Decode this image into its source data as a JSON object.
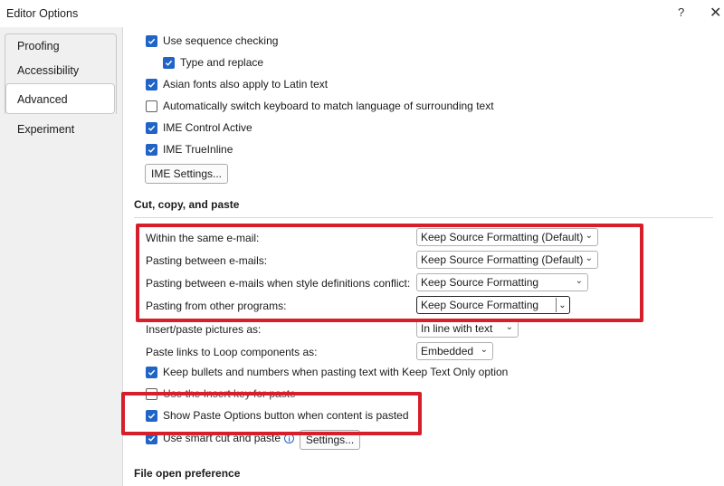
{
  "window": {
    "title": "Editor Options",
    "help": "?",
    "close": "✕"
  },
  "sidebar": {
    "items": [
      {
        "label": "Proofing"
      },
      {
        "label": "Accessibility"
      },
      {
        "label": "Advanced"
      },
      {
        "label": "Experiment"
      }
    ]
  },
  "options_top": [
    {
      "label": "Use sequence checking",
      "checked": true
    },
    {
      "label": "Type and replace",
      "checked": true
    },
    {
      "label": "Asian fonts also apply to Latin text",
      "checked": true
    },
    {
      "label": "Automatically switch keyboard to match language of surrounding text",
      "checked": false
    },
    {
      "label": "IME Control Active",
      "checked": true
    },
    {
      "label": "IME TrueInline",
      "checked": true
    }
  ],
  "ime_settings_button": "IME Settings...",
  "sections": {
    "cut_copy_paste": "Cut, copy, and paste",
    "file_open": "File open preference"
  },
  "paste_settings": [
    {
      "label": "Within the same e-mail:",
      "value": "Keep Source Formatting (Default)"
    },
    {
      "label": "Pasting between e-mails:",
      "value": "Keep Source Formatting (Default)"
    },
    {
      "label": "Pasting between e-mails when style definitions conflict:",
      "value": "Keep Source Formatting"
    },
    {
      "label": "Pasting from other programs:",
      "value": "Keep Source Formatting"
    },
    {
      "label": "Insert/paste pictures as:",
      "value": "In line with text"
    },
    {
      "label": "Paste links to Loop components as:",
      "value": "Embedded"
    }
  ],
  "options_bottom": [
    {
      "label": "Keep bullets and numbers when pasting text with Keep Text Only option",
      "checked": true
    },
    {
      "label": "Use the Insert key for paste",
      "checked": false
    },
    {
      "label": "Show Paste Options button when content is pasted",
      "checked": true
    },
    {
      "label": "Use smart cut and paste",
      "checked": true
    }
  ],
  "settings_button": "Settings...",
  "info_icon": "i",
  "colors": {
    "accent": "#1f64c6",
    "highlight": "#d61f2b"
  }
}
